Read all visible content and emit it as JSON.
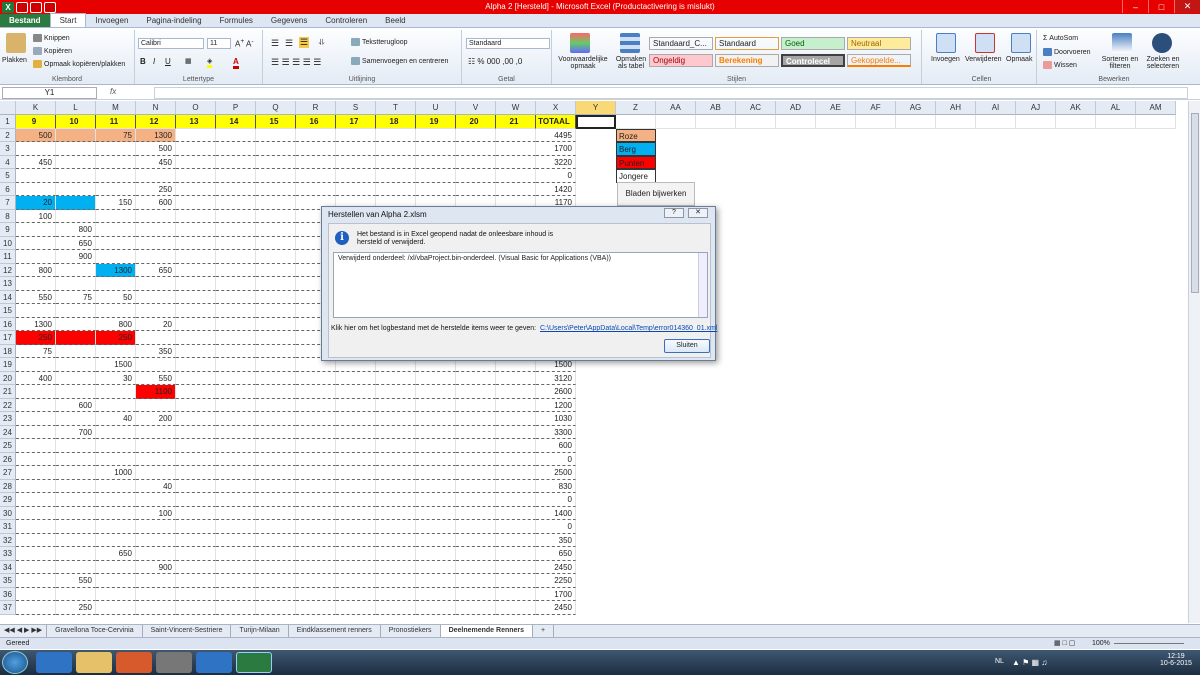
{
  "window": {
    "title": "Alpha 2 [Hersteld]  -  Microsoft Excel (Productactivering is mislukt)",
    "minimize_icon": "minimize-icon",
    "maximize_icon": "maximize-icon",
    "close_icon": "close-icon"
  },
  "ribbon_tabs": [
    "Bestand",
    "Start",
    "Invoegen",
    "Pagina-indeling",
    "Formules",
    "Gegevens",
    "Controleren",
    "Beeld"
  ],
  "clipboard": {
    "paste": "Plakken",
    "cut": "Knippen",
    "copy": "Kopiëren",
    "format_painter": "Opmaak kopiëren/plakken",
    "label": "Klembord"
  },
  "font": {
    "name": "Calibri",
    "size": "11",
    "label": "Lettertype"
  },
  "alignment": {
    "wrap": "Tekstterugloop",
    "merge": "Samenvoegen en centreren",
    "label": "Uitlijning"
  },
  "number": {
    "format": "Standaard",
    "label": "Getal"
  },
  "styles": {
    "conditional": "Voorwaardelijke opmaak",
    "table": "Opmaken als tabel",
    "cells": [
      {
        "text": "Standaard_C...",
        "bg": "#ffffff",
        "fg": "#222222"
      },
      {
        "text": "Standaard",
        "bg": "#ffffff",
        "fg": "#222222"
      },
      {
        "text": "Goed",
        "bg": "#c6efce",
        "fg": "#006100"
      },
      {
        "text": "Neutraal",
        "bg": "#ffeb9c",
        "fg": "#9c6500"
      },
      {
        "text": "Ongeldig",
        "bg": "#ffc7ce",
        "fg": "#9c0006"
      },
      {
        "text": "Berekening",
        "bg": "#f2f2f2",
        "fg": "#fa7d00"
      },
      {
        "text": "Controlecel",
        "bg": "#a5a5a5",
        "fg": "#ffffff"
      },
      {
        "text": "Gekoppelde...",
        "bg": "#ffffff",
        "fg": "#fa7d00"
      }
    ],
    "label": "Stijlen"
  },
  "cells_group": {
    "insert": "Invoegen",
    "delete": "Verwijderen",
    "format": "Opmaak",
    "label": "Cellen"
  },
  "editing": {
    "autosum": "AutoSom",
    "fill": "Doorvoeren",
    "clear": "Wissen",
    "sort": "Sorteren en filteren",
    "find": "Zoeken en selecteren",
    "label": "Bewerken"
  },
  "formula_bar": {
    "name_box": "Y1",
    "fx": "fx",
    "value": ""
  },
  "columns": [
    "K",
    "L",
    "M",
    "N",
    "O",
    "P",
    "Q",
    "R",
    "S",
    "T",
    "U",
    "V",
    "W",
    "X",
    "Y",
    "Z",
    "AA",
    "AB",
    "AC",
    "AD",
    "AE",
    "AF",
    "AG",
    "AH",
    "AI",
    "AJ",
    "AK",
    "AL",
    "AM"
  ],
  "header_row": [
    "9",
    "10",
    "11",
    "12",
    "13",
    "14",
    "15",
    "16",
    "17",
    "18",
    "19",
    "20",
    "21",
    "TOTAAL"
  ],
  "rows": [
    {
      "n": "2",
      "K": "500",
      "M": "75",
      "N": "1300",
      "X": "4495"
    },
    {
      "n": "3",
      "N": "500",
      "X": "1700"
    },
    {
      "n": "4",
      "K": "450",
      "N": "450",
      "X": "3220"
    },
    {
      "n": "5",
      "X": "0"
    },
    {
      "n": "6",
      "N": "250",
      "X": "1420"
    },
    {
      "n": "7",
      "K": "20",
      "M": "150",
      "N": "600",
      "X": "1170"
    },
    {
      "n": "8",
      "K": "100"
    },
    {
      "n": "9",
      "L": "800"
    },
    {
      "n": "10",
      "L": "650"
    },
    {
      "n": "11",
      "L": "900"
    },
    {
      "n": "12",
      "K": "800",
      "M": "1300",
      "N": "650"
    },
    {
      "n": "13"
    },
    {
      "n": "14",
      "K": "550",
      "L": "75",
      "M": "50"
    },
    {
      "n": "15"
    },
    {
      "n": "16",
      "K": "1300",
      "M": "800",
      "N": "20"
    },
    {
      "n": "17",
      "K": "250",
      "M": "250"
    },
    {
      "n": "18",
      "K": "75",
      "N": "350"
    },
    {
      "n": "19",
      "M": "1500",
      "X": "1500"
    },
    {
      "n": "20",
      "K": "400",
      "M": "30",
      "N": "550",
      "X": "3120"
    },
    {
      "n": "21",
      "N": "1100",
      "X": "2600"
    },
    {
      "n": "22",
      "L": "600",
      "X": "1200"
    },
    {
      "n": "23",
      "M": "40",
      "N": "200",
      "X": "1030"
    },
    {
      "n": "24",
      "L": "700",
      "X": "3300"
    },
    {
      "n": "25",
      "X": "600"
    },
    {
      "n": "26",
      "X": "0"
    },
    {
      "n": "27",
      "M": "1000",
      "X": "2500"
    },
    {
      "n": "28",
      "N": "40",
      "X": "830"
    },
    {
      "n": "29",
      "X": "0"
    },
    {
      "n": "30",
      "N": "100",
      "X": "1400"
    },
    {
      "n": "31",
      "X": "0"
    },
    {
      "n": "32",
      "X": "350"
    },
    {
      "n": "33",
      "M": "650",
      "X": "650"
    },
    {
      "n": "34",
      "N": "900",
      "X": "2450"
    },
    {
      "n": "35",
      "L": "550",
      "X": "2250"
    },
    {
      "n": "36",
      "X": "1700"
    },
    {
      "n": "37",
      "L": "250",
      "X": "2450"
    }
  ],
  "legend": [
    {
      "text": "Roze",
      "bg": "#f4b183"
    },
    {
      "text": "Berg",
      "bg": "#00b0f0"
    },
    {
      "text": "Punten",
      "bg": "#ff0000"
    },
    {
      "text": "Jongere",
      "bg": "#ffffff"
    }
  ],
  "bladen_button": "Bladen bijwerken",
  "dialog": {
    "title": "Herstellen van Alpha 2.xlsm",
    "help_icon": "help-icon",
    "close_icon": "close-icon",
    "message": "Het bestand is in Excel geopend nadat de onleesbare inhoud is hersteld of verwijderd.",
    "details": "Verwijderd onderdeel: /xl/vbaProject.bin-onderdeel.  (Visual Basic for Applications (VBA))",
    "log_label": "Klik hier om het logbestand met de herstelde items weer te geven:",
    "log_link": "C:\\Users\\Peter\\AppData\\Local\\Temp\\error014360_01.xml",
    "close_button": "Sluiten"
  },
  "sheet_tabs": [
    "Gravellona Toce-Cervinia",
    "Saint-Vincent-Sestriere",
    "Turijn-Milaan",
    "Eindklassement renners",
    "Pronostiekers",
    "Deelnemende Renners"
  ],
  "status": {
    "left": "Gereed",
    "zoom": "100%"
  },
  "taskbar": {
    "lang": "NL",
    "time": "12:19",
    "date": "10-6-2015"
  }
}
